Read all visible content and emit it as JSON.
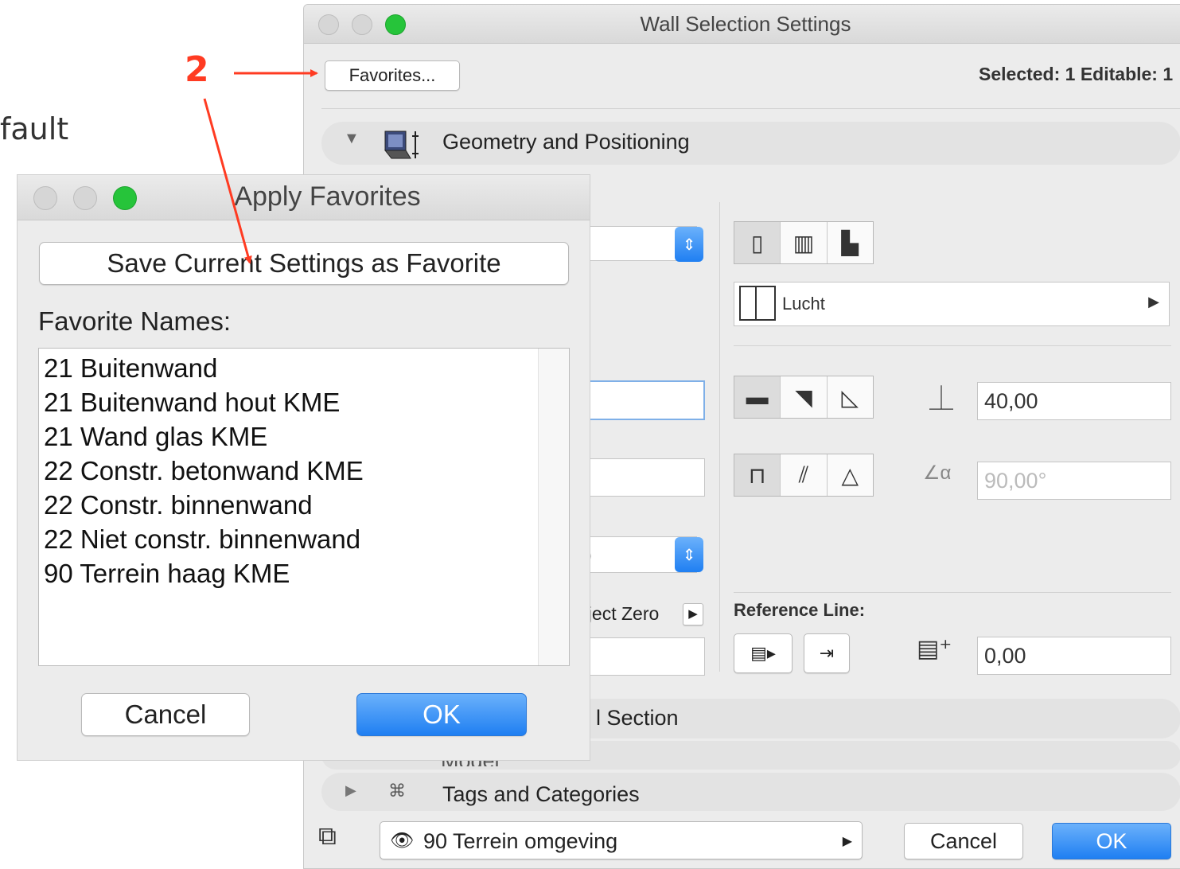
{
  "background": {
    "partial_text": "fault",
    "step_number": "2",
    "annotation_color": "#ff3b22"
  },
  "main_window": {
    "title": "Wall Selection Settings",
    "favorites_button": "Favorites...",
    "selected_info": "Selected: 1 Editable: 1",
    "section_geometry": "Geometry and Positioning",
    "section_partial": "l Section",
    "section_partial_model": "Model",
    "section_tags": "Tags and Categories",
    "composite_label": "Lucht",
    "thickness_value": "40,00",
    "angle_value": "90,00°",
    "popup_partial_text": ")",
    "project_zero_label": "oject Zero",
    "reference_line_label": "Reference Line:",
    "offset_value": "0,00",
    "layer_name": "90 Terrein omgeving",
    "cancel_button": "Cancel",
    "ok_button": "OK"
  },
  "favorites_dialog": {
    "title": "Apply Favorites",
    "save_button": "Save Current Settings as Favorite",
    "list_label": "Favorite Names:",
    "items": [
      "21 Buitenwand",
      "21 Buitenwand hout KME",
      "21 Wand glas KME",
      "22 Constr. betonwand KME",
      "22 Constr. binnenwand",
      "22 Niet constr. binnenwand",
      "90 Terrein haag KME"
    ],
    "cancel_button": "Cancel",
    "ok_button": "OK"
  }
}
